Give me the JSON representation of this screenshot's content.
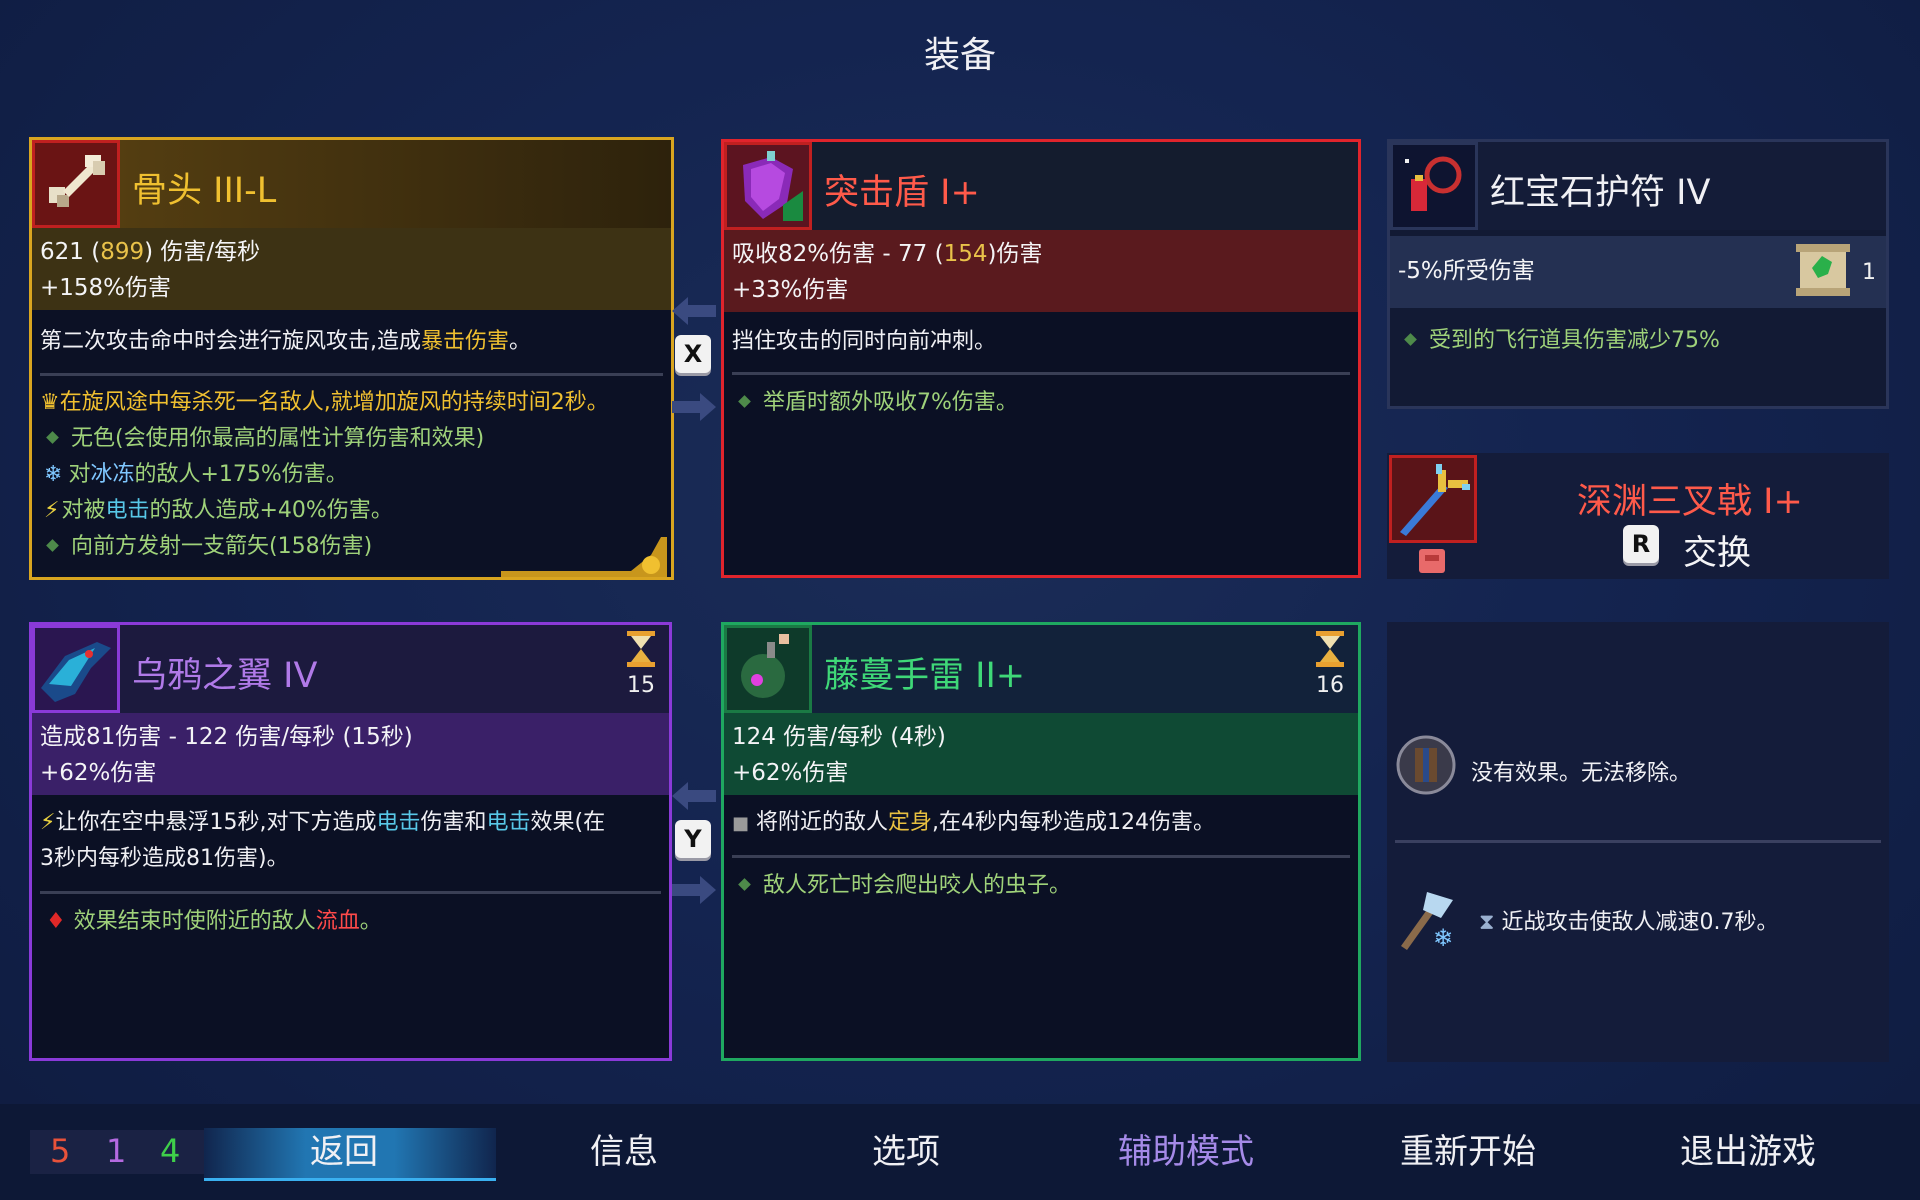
{
  "screen_title": "装备",
  "slots": {
    "bone": {
      "name": "骨头",
      "tier": "III-L",
      "dps_base": "621",
      "dps_crit": "899",
      "dps_unit": "伤害/每秒",
      "bonus": "+158%伤害",
      "desc_prefix": "第二次攻击命中时会进行旋风攻击,造成",
      "desc_highlight": "暴击伤害",
      "desc_suffix": "。",
      "legendary": "在旋风途中每杀死一名敌人,就增加旋风的持续时间2秒。",
      "affixes": [
        {
          "text": "无色(会使用你最高的属性计算伤害和效果)",
          "icon": "diamond-bullet"
        },
        {
          "pre": "对",
          "hl": "冰冻",
          "post": "的敌人+175%伤害。",
          "icon": "snowflake-icon"
        },
        {
          "pre": "对被",
          "hl": "电击",
          "post": "的敌人造成+40%伤害。",
          "icon": "lightning-icon"
        },
        {
          "text": "向前方发射一支箭矢(158伤害)",
          "icon": "diamond-bullet"
        }
      ],
      "color": "#d9a520"
    },
    "shield": {
      "name": "突击盾",
      "tier": "I+",
      "stat_pre": "吸收82%伤害 - 77 (",
      "stat_crit": "154",
      "stat_post": ")伤害",
      "bonus": "+33%伤害",
      "desc": "挡住攻击的同时向前冲刺。",
      "affix": "举盾时额外吸收7%伤害。",
      "color": "#e0242c"
    },
    "amulet": {
      "name": "红宝石护符",
      "tier": "IV",
      "stat": "-5%所受伤害",
      "scroll_count": "1",
      "affix": "受到的飞行道具伤害减少75%"
    },
    "backpack": {
      "name": "深渊三叉戟",
      "tier": "I+",
      "key": "R",
      "action": "交换"
    },
    "wings": {
      "name": "乌鸦之翼",
      "tier": "IV",
      "cooldown": "15",
      "stat": "造成81伤害 - 122 伤害/每秒 (15秒)",
      "bonus": "+62%伤害",
      "desc_a": "让你在空中悬浮15秒,对下方造成",
      "desc_hl1": "电击",
      "desc_b": "伤害和",
      "desc_hl2": "电击",
      "desc_c": "效果(在",
      "desc_line2": "3秒内每秒造成81伤害)。",
      "affix_pre": "效果结束时使附近的敌人",
      "affix_hl": "流血",
      "affix_post": "。",
      "color": "#8a3ad8"
    },
    "grenade": {
      "name": "藤蔓手雷",
      "tier": "II+",
      "cooldown": "16",
      "stat": "124 伤害/每秒 (4秒)",
      "bonus": "+62%伤害",
      "desc_pre": "将附近的敌人",
      "desc_hl": "定身",
      "desc_post": ",在4秒内每秒造成124伤害。",
      "affix": "敌人死亡时会爬出咬人的虫子。",
      "color": "#1fa860"
    }
  },
  "swap_keys": {
    "top": "X",
    "bottom": "Y"
  },
  "mutations": [
    {
      "text": "没有效果。无法移除。",
      "icon": "cursed-shield-icon"
    },
    {
      "text": "近战攻击使敌人减速0.7秒。",
      "icon": "frost-axe-icon"
    }
  ],
  "scrolls": {
    "brutality": "5",
    "tactics": "1",
    "survival": "4"
  },
  "nav": {
    "back": "返回",
    "info": "信息",
    "options": "选项",
    "assist": "辅助模式",
    "restart": "重新开始",
    "quit": "退出游戏"
  },
  "colors": {
    "brutality": "#e8523a",
    "tactics": "#b46ae0",
    "survival": "#3fcf4a",
    "assist": "#a58ae8",
    "legendary_gold": "#f0c030",
    "electric": "#58c8e8",
    "bleed": "#ff4a4a"
  }
}
